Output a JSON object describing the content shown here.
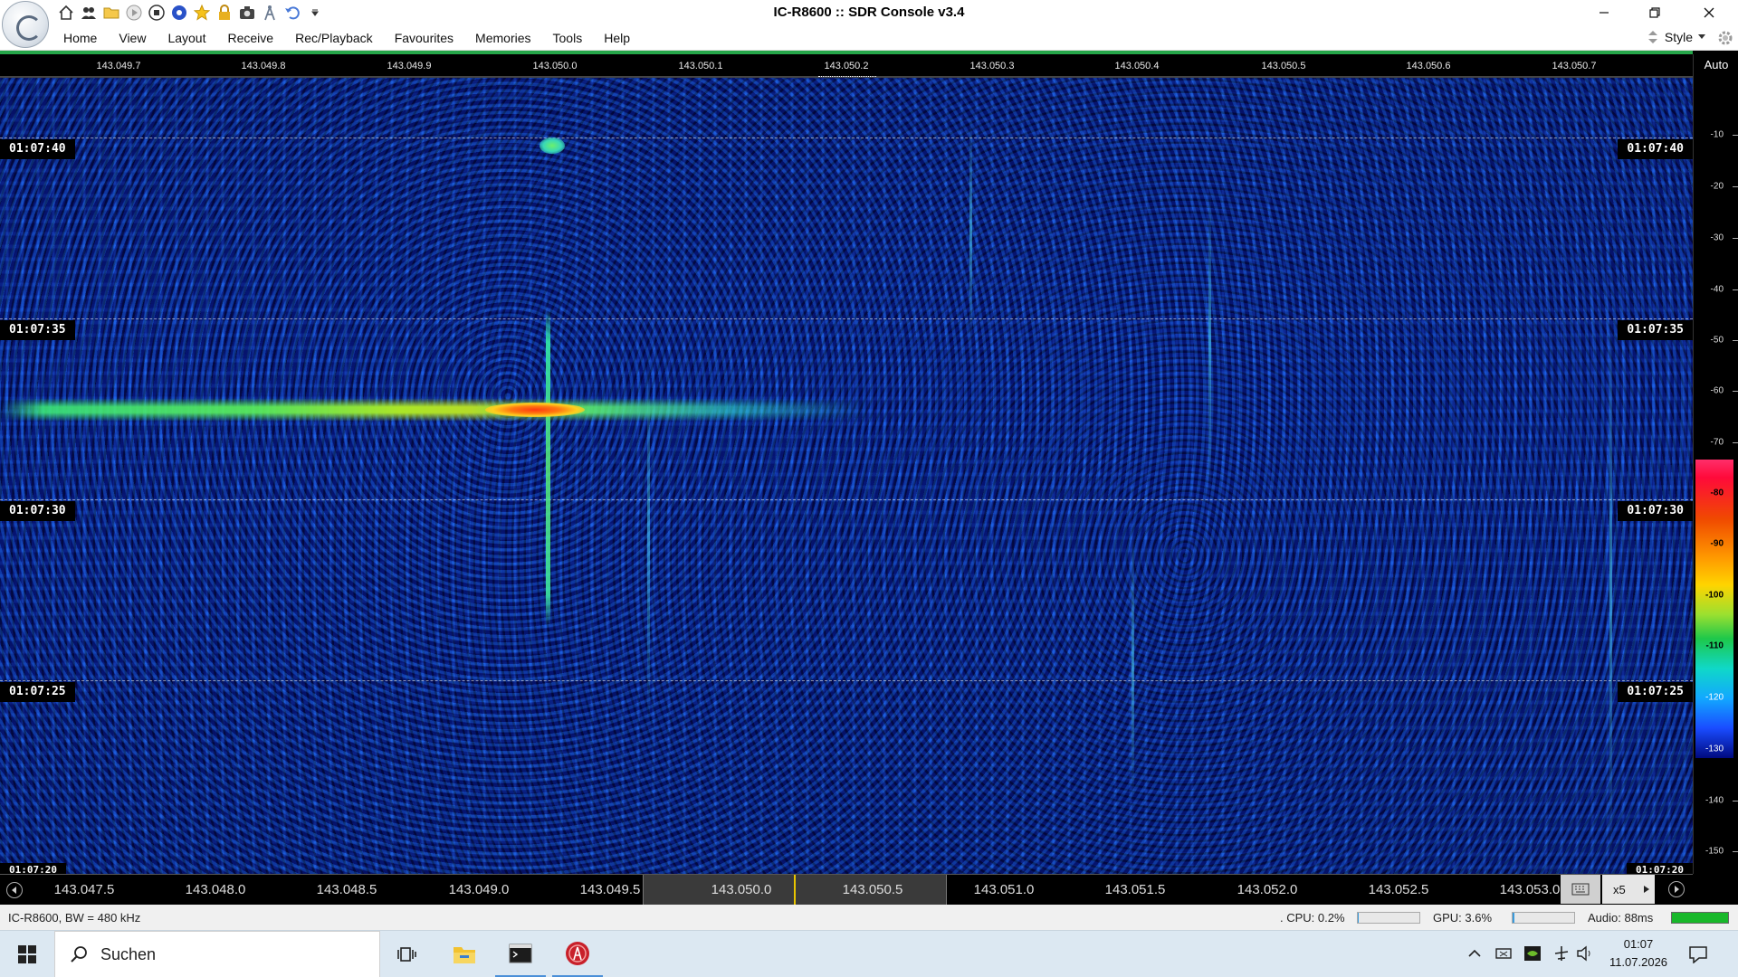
{
  "window": {
    "title": "IC-R8600 :: SDR Console v3.4"
  },
  "quick_access": [
    "home-icon",
    "users-icon",
    "folder-icon",
    "play-icon",
    "stop-icon",
    "record-icon",
    "favourite-star-icon",
    "lock-icon",
    "camera-icon",
    "antenna-icon",
    "undo-icon",
    "dropdown-icon"
  ],
  "menu": {
    "items": [
      "Home",
      "View",
      "Layout",
      "Receive",
      "Rec/Playback",
      "Favourites",
      "Memories",
      "Tools",
      "Help"
    ],
    "style_label": "Style"
  },
  "frequency_ruler": {
    "ticks": [
      "143.049.7",
      "143.049.8",
      "143.049.9",
      "143.050.0",
      "143.050.1",
      "143.050.2",
      "143.050.3",
      "143.050.4",
      "143.050.5",
      "143.050.6",
      "143.050.7"
    ]
  },
  "waterfall": {
    "time_labels": [
      "01:07:40",
      "01:07:35",
      "01:07:30",
      "01:07:25",
      "01:07:20"
    ],
    "colors": {
      "background": "#0b22c4",
      "signal": "#ff3a10"
    }
  },
  "level_scale": {
    "mode_label": "Auto",
    "ticks": [
      "-10",
      "-20",
      "-30",
      "-40",
      "-50",
      "-60",
      "-70",
      "-80",
      "-90",
      "-100",
      "-110",
      "-120",
      "-130",
      "-140",
      "-150"
    ]
  },
  "frequency_bar": {
    "ticks": [
      "143.047.5",
      "143.048.0",
      "143.048.5",
      "143.049.0",
      "143.049.5",
      "143.050.0",
      "143.050.5",
      "143.051.0",
      "143.051.5",
      "143.052.0",
      "143.052.5",
      "143.053.0"
    ],
    "zoom": "x5"
  },
  "status": {
    "radio": "IC-R8600, BW = 480 kHz",
    "cpu": ". CPU: 0.2%",
    "cpu_level": 0.002,
    "gpu": "GPU: 3.6%",
    "gpu_level": 0.036,
    "audio": "Audio: 88ms",
    "audio_color": "#18b82a"
  },
  "taskbar": {
    "search_placeholder": "Suchen",
    "time": "01:07",
    "date": "11.07.2026"
  }
}
